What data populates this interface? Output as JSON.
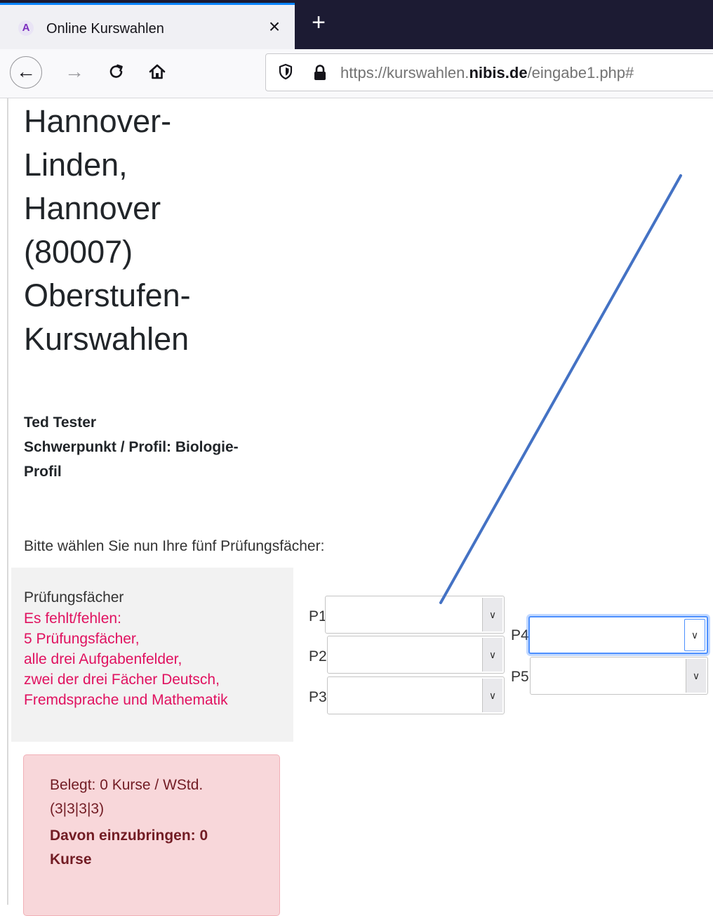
{
  "browser": {
    "tab_title": "Online Kurswahlen",
    "tab_close_icon": "×",
    "new_tab_icon": "+",
    "favicon_letter": "A",
    "back_icon": "←",
    "forward_icon": "→",
    "reload_icon": "C",
    "home_icon": "⌂",
    "shield_icon": "⛉",
    "url": {
      "prefix": "https://kurswahlen.",
      "domain": "nibis.de",
      "path": "/eingabe1.php#"
    },
    "colors": {
      "tabbar": "#1c1b33",
      "tab_accent": "#0a84ff"
    }
  },
  "page": {
    "heading_lines": [
      "Hannover-",
      "Linden,",
      "Hannover",
      "(80007)",
      "Oberstufen-",
      "Kurswahlen"
    ],
    "student_name": "Ted Tester",
    "profile_line1": "Schwerpunkt / Profil: Biologie-",
    "profile_line2": "Profil",
    "intro": "Bitte wählen Sie nun Ihre fünf Prüfungsfächer:",
    "panel": {
      "title": "Prüfungsfächer",
      "missing_lines": [
        "Es fehlt/fehlen:",
        "5 Prüfungsfächer,",
        "alle drei Aufgabenfelder,",
        "zwei der drei Fächer Deutsch,",
        "Fremdsprache und Mathematik"
      ],
      "missing_color": "#e0115f"
    },
    "selects": [
      {
        "label": "P1",
        "value": ""
      },
      {
        "label": "P2",
        "value": ""
      },
      {
        "label": "P3",
        "value": ""
      },
      {
        "label": "P4",
        "value": ""
      },
      {
        "label": "P5",
        "value": ""
      }
    ],
    "summary": {
      "line1": "Belegt: 0 Kurse / WStd.",
      "line2": "(3|3|3|3)",
      "strong_line1": "Davon einzubringen: 0",
      "strong_line2": "Kurse",
      "color": "#721c24",
      "background": "#f8d7da"
    }
  }
}
